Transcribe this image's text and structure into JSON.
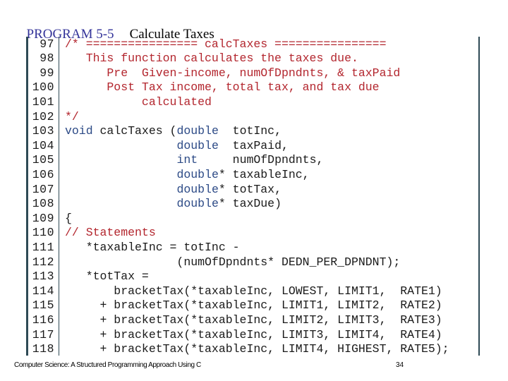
{
  "header": {
    "program_number": "PROGRAM 5-5",
    "program_title": "Calculate Taxes",
    "number_color": "#333399"
  },
  "colors": {
    "comment": "#b3262e",
    "keyword": "#2c4a86",
    "code": "#1a1a1a",
    "border": "#2e4a55"
  },
  "listing": {
    "lines": [
      {
        "num": "97",
        "segments": [
          {
            "t": "cm",
            "text": "/* ================ calcTaxes ================"
          }
        ]
      },
      {
        "num": "98",
        "segments": [
          {
            "t": "cm",
            "text": "   This function calculates the taxes due."
          }
        ]
      },
      {
        "num": "99",
        "segments": [
          {
            "t": "cm",
            "text": "      Pre  Given-income, numOfDpndnts, & taxPaid"
          }
        ]
      },
      {
        "num": "100",
        "segments": [
          {
            "t": "cm",
            "text": "      Post Tax income, total tax, and tax due"
          }
        ]
      },
      {
        "num": "101",
        "segments": [
          {
            "t": "cm",
            "text": "           calculated"
          }
        ]
      },
      {
        "num": "102",
        "segments": [
          {
            "t": "cm",
            "text": "*/"
          }
        ]
      },
      {
        "num": "103",
        "segments": [
          {
            "t": "kw",
            "text": "void"
          },
          {
            "t": "",
            "text": " calcTaxes ("
          },
          {
            "t": "kw",
            "text": "double"
          },
          {
            "t": "",
            "text": "  totInc,"
          }
        ]
      },
      {
        "num": "104",
        "segments": [
          {
            "t": "",
            "text": "                "
          },
          {
            "t": "kw",
            "text": "double"
          },
          {
            "t": "",
            "text": "  taxPaid,"
          }
        ]
      },
      {
        "num": "105",
        "segments": [
          {
            "t": "",
            "text": "                "
          },
          {
            "t": "kw",
            "text": "int"
          },
          {
            "t": "",
            "text": "     numOfDpndnts,"
          }
        ]
      },
      {
        "num": "106",
        "segments": [
          {
            "t": "",
            "text": "                "
          },
          {
            "t": "kw",
            "text": "double"
          },
          {
            "t": "",
            "text": "* taxableInc,"
          }
        ]
      },
      {
        "num": "107",
        "segments": [
          {
            "t": "",
            "text": "                "
          },
          {
            "t": "kw",
            "text": "double"
          },
          {
            "t": "",
            "text": "* totTax,"
          }
        ]
      },
      {
        "num": "108",
        "segments": [
          {
            "t": "",
            "text": "                "
          },
          {
            "t": "kw",
            "text": "double"
          },
          {
            "t": "",
            "text": "* taxDue)"
          }
        ]
      },
      {
        "num": "109",
        "segments": [
          {
            "t": "",
            "text": "{"
          }
        ]
      },
      {
        "num": "110",
        "segments": [
          {
            "t": "cm",
            "text": "// Statements"
          }
        ]
      },
      {
        "num": "111",
        "segments": [
          {
            "t": "",
            "text": "   *taxableInc = totInc -"
          }
        ]
      },
      {
        "num": "112",
        "segments": [
          {
            "t": "",
            "text": "                (numOfDpndnts* DEDN_PER_DPNDNT);"
          }
        ]
      },
      {
        "num": "113",
        "segments": [
          {
            "t": "",
            "text": "   *totTax ="
          }
        ]
      },
      {
        "num": "114",
        "segments": [
          {
            "t": "",
            "text": "       bracketTax(*taxableInc, LOWEST, LIMIT1,  RATE1)"
          }
        ]
      },
      {
        "num": "115",
        "segments": [
          {
            "t": "",
            "text": "     + bracketTax(*taxableInc, LIMIT1, LIMIT2,  RATE2)"
          }
        ]
      },
      {
        "num": "116",
        "segments": [
          {
            "t": "",
            "text": "     + bracketTax(*taxableInc, LIMIT2, LIMIT3,  RATE3)"
          }
        ]
      },
      {
        "num": "117",
        "segments": [
          {
            "t": "",
            "text": "     + bracketTax(*taxableInc, LIMIT3, LIMIT4,  RATE4)"
          }
        ]
      },
      {
        "num": "118",
        "segments": [
          {
            "t": "",
            "text": "     + bracketTax(*taxableInc, LIMIT4, HIGHEST, RATE5);"
          }
        ]
      }
    ]
  },
  "footer": {
    "book_title": "Computer Science: A Structured Programming Approach Using C",
    "page_number": "34"
  }
}
